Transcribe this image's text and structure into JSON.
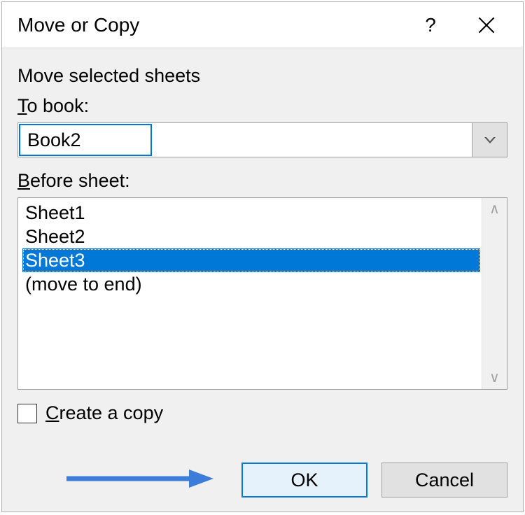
{
  "title": "Move or Copy",
  "labels": {
    "move_selected": "Move selected sheets",
    "to_book": {
      "prefix": "T",
      "rest": "o book:"
    },
    "before_sheet": {
      "prefix": "B",
      "rest": "efore sheet:"
    },
    "create_copy": {
      "prefix": "C",
      "rest": "reate a copy"
    }
  },
  "to_book_value": "Book2",
  "sheet_list": {
    "items": [
      "Sheet1",
      "Sheet2",
      "Sheet3",
      "(move to end)"
    ],
    "selected_index": 2
  },
  "create_copy_checked": false,
  "buttons": {
    "ok": "OK",
    "cancel": "Cancel"
  },
  "colors": {
    "accent": "#0078d7",
    "dialog_bg": "#f0f0f0",
    "btn_bg": "#e1e1e1",
    "primary_btn_bg": "#e5f1fb",
    "annotation_arrow": "#3b7dd8"
  }
}
